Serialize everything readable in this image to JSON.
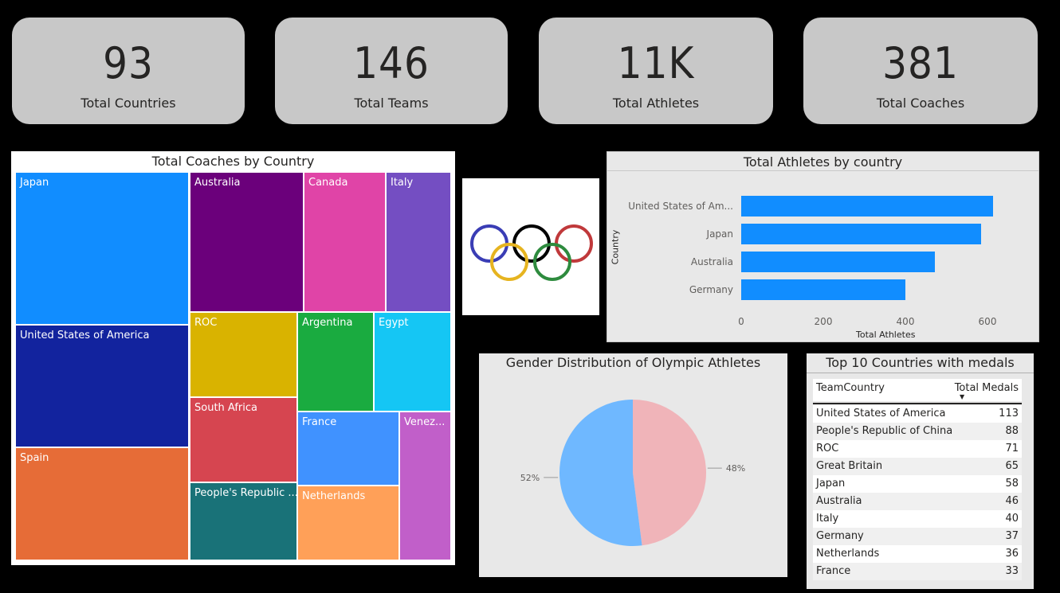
{
  "kpis": [
    {
      "value": "93",
      "label": "Total Countries"
    },
    {
      "value": "146",
      "label": "Total Teams"
    },
    {
      "value": "11K",
      "label": "Total Athletes"
    },
    {
      "value": "381",
      "label": "Total Coaches"
    }
  ],
  "treemap": {
    "title": "Total Coaches by Country",
    "tiles": [
      {
        "label": "Japan",
        "color": "#118dff"
      },
      {
        "label": "United States of America",
        "color": "#12239e"
      },
      {
        "label": "Spain",
        "color": "#e66c37"
      },
      {
        "label": "Australia",
        "color": "#6b007b"
      },
      {
        "label": "Canada",
        "color": "#e044a7"
      },
      {
        "label": "Italy",
        "color": "#744ec2"
      },
      {
        "label": "ROC",
        "color": "#d9b300"
      },
      {
        "label": "Argentina",
        "color": "#1aab40"
      },
      {
        "label": "Egypt",
        "color": "#15c6f4"
      },
      {
        "label": "South Africa",
        "color": "#d64550"
      },
      {
        "label": "France",
        "color": "#4092ff"
      },
      {
        "label": "Venez...",
        "color": "#c15fc9"
      },
      {
        "label": "People's Republic ...",
        "color": "#197278"
      },
      {
        "label": "Netherlands",
        "color": "#ffa058"
      }
    ]
  },
  "chart_data": [
    {
      "type": "bar",
      "orientation": "horizontal",
      "title": "Total Athletes by country",
      "ylabel": "Country",
      "xlabel": "Total Athletes",
      "categories": [
        "United States of Am...",
        "Japan",
        "Australia",
        "Germany"
      ],
      "values": [
        613,
        584,
        471,
        400
      ],
      "xticks": [
        "0",
        "200",
        "400",
        "600"
      ],
      "xlim": [
        0,
        650
      ],
      "color": "#118dff"
    },
    {
      "type": "pie",
      "title": "Gender Distribution of Olympic Athletes",
      "slices": [
        {
          "value": 48,
          "label": "48%",
          "color": "#f0b4b9"
        },
        {
          "value": 52,
          "label": "52%",
          "color": "#6fb8ff"
        }
      ]
    },
    {
      "type": "table",
      "title": "Top 10 Countries with medals",
      "columns": [
        "TeamCountry",
        "Total Medals"
      ],
      "rows": [
        [
          "United States of America",
          "113"
        ],
        [
          "People's Republic of China",
          "88"
        ],
        [
          "ROC",
          "71"
        ],
        [
          "Great Britain",
          "65"
        ],
        [
          "Japan",
          "58"
        ],
        [
          "Australia",
          "46"
        ],
        [
          "Italy",
          "40"
        ],
        [
          "Germany",
          "37"
        ],
        [
          "Netherlands",
          "36"
        ],
        [
          "France",
          "33"
        ]
      ]
    }
  ],
  "logo": {
    "name": "olympic-rings-icon",
    "colors": [
      "#3a3db5",
      "#000000",
      "#c0393b",
      "#e6b420",
      "#2e8b3e"
    ]
  }
}
